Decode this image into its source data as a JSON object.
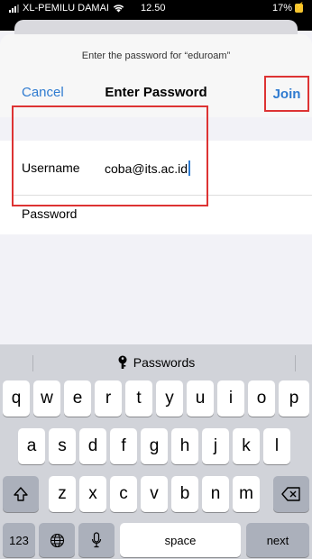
{
  "status_bar": {
    "carrier": "XL-PEMILU DAMAI",
    "time": "12.50",
    "battery": "17%"
  },
  "dialog": {
    "prompt": "Enter the password for “eduroam”",
    "cancel_label": "Cancel",
    "title": "Enter Password",
    "join_label": "Join"
  },
  "form": {
    "username_label": "Username",
    "username_value": "coba@its.ac.id",
    "password_label": "Password"
  },
  "keyboard": {
    "suggestion": "Passwords",
    "row1": [
      "q",
      "w",
      "e",
      "r",
      "t",
      "y",
      "u",
      "i",
      "o",
      "p"
    ],
    "row2": [
      "a",
      "s",
      "d",
      "f",
      "g",
      "h",
      "j",
      "k",
      "l"
    ],
    "row3": [
      "z",
      "x",
      "c",
      "v",
      "b",
      "n",
      "m"
    ],
    "numbers_label": "123",
    "space_label": "space",
    "next_label": "next"
  },
  "colors": {
    "accent": "#2f7bd0",
    "highlight": "#dd3333"
  }
}
